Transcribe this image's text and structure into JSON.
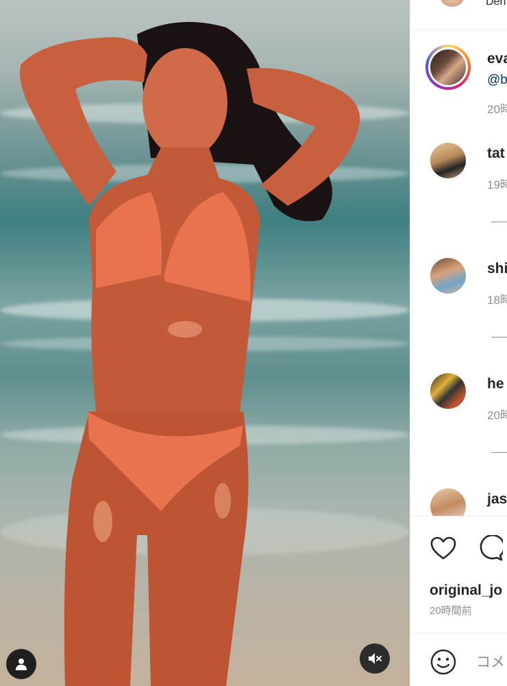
{
  "post": {
    "tag_icon": "user-icon",
    "mute_icon": "speaker-muted-icon"
  },
  "top_strip": {
    "text": "Den"
  },
  "comments": [
    {
      "username": "eva",
      "mention": "@b",
      "time": "20時"
    },
    {
      "username": "tat",
      "time": "19時"
    },
    {
      "username": "shi",
      "time": "18時"
    },
    {
      "username": "he",
      "time": "20時"
    },
    {
      "username": "jas"
    }
  ],
  "actions": {
    "like_icon": "heart-icon",
    "comment_icon": "comment-bubble-icon"
  },
  "footer": {
    "poster_username": "original_jo",
    "post_time": "20時間前",
    "comment_placeholder": "コメ",
    "emoji_icon": "emoji-icon"
  }
}
